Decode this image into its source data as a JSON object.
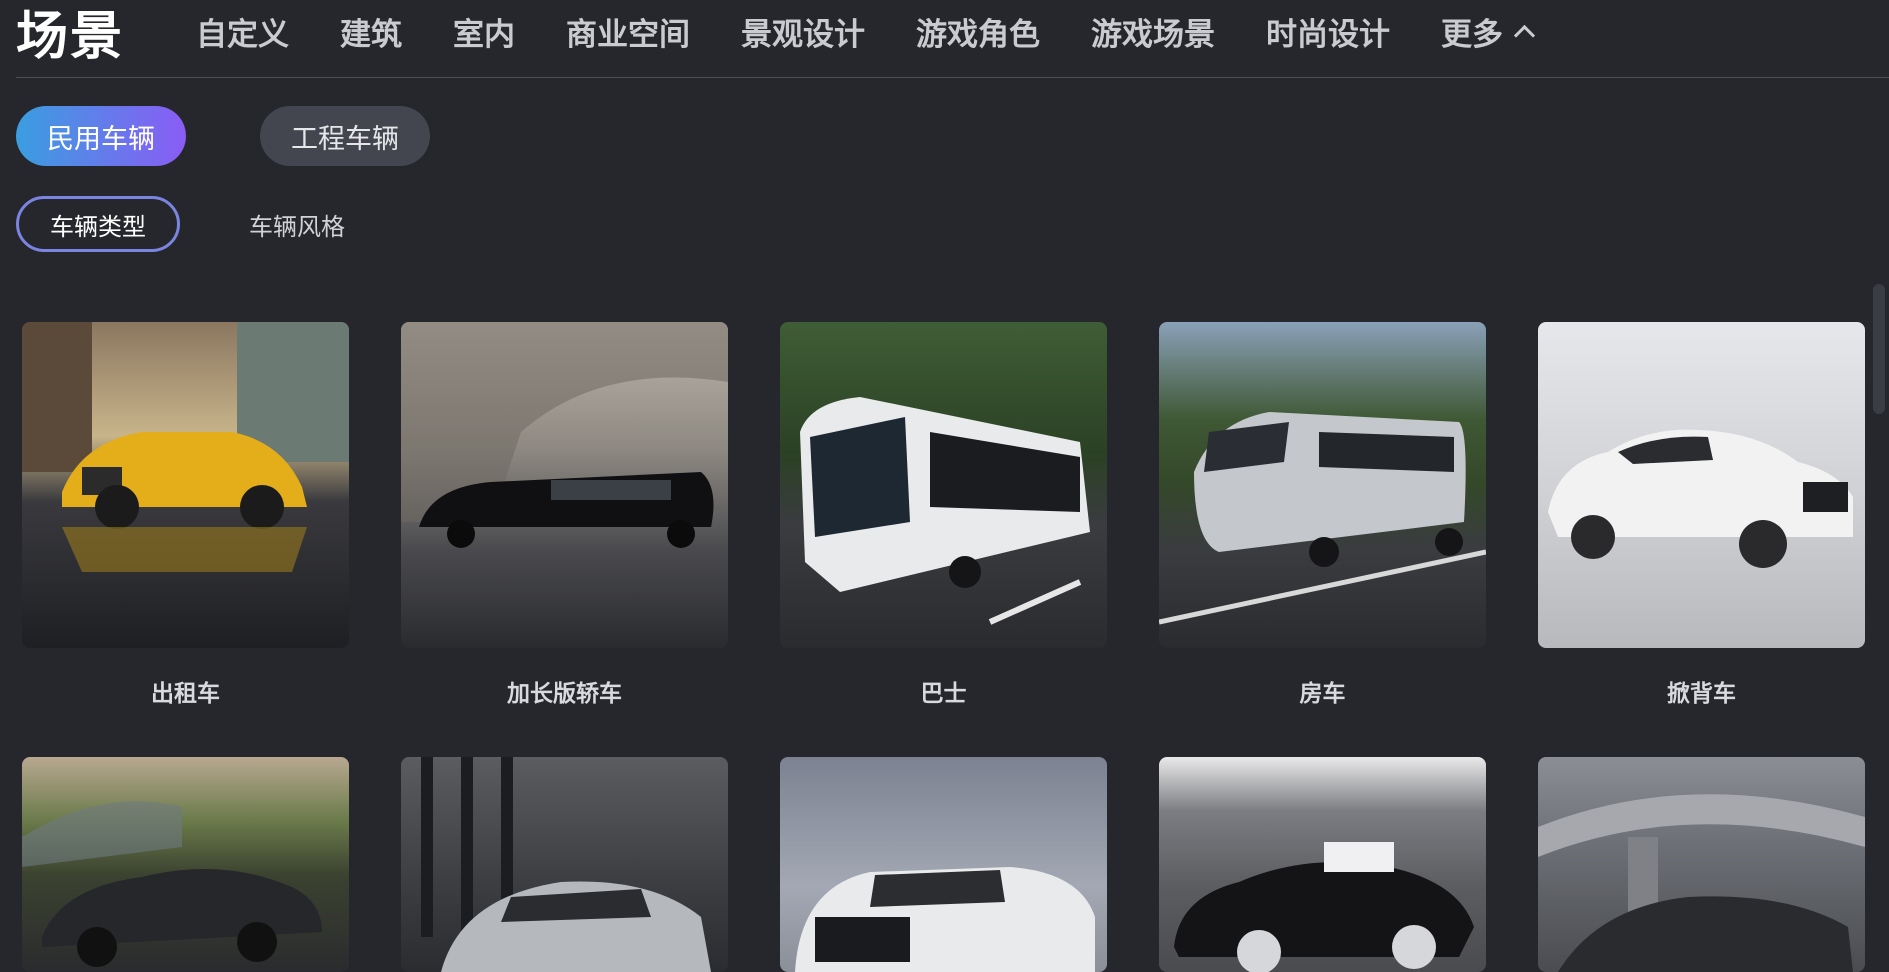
{
  "header": {
    "logo": "场景",
    "nav": [
      "自定义",
      "建筑",
      "室内",
      "商业空间",
      "景观设计",
      "游戏角色",
      "游戏场景",
      "时尚设计"
    ],
    "more_label": "更多"
  },
  "category_pills": [
    {
      "label": "民用车辆",
      "active": true
    },
    {
      "label": "工程车辆",
      "active": false
    }
  ],
  "sub_tabs": [
    {
      "label": "车辆类型",
      "active": true
    },
    {
      "label": "车辆风格",
      "active": false
    }
  ],
  "cards": [
    {
      "label": "出租车",
      "image": "yellow taxi on wet city street"
    },
    {
      "label": "加长版轿车",
      "image": "black stretch limousine under concrete structure"
    },
    {
      "label": "巴士",
      "image": "white coach bus on road with trees"
    },
    {
      "label": "房车",
      "image": "silver motorhome on highway"
    },
    {
      "label": "掀背车",
      "image": "white hatchback car studio shot"
    },
    {
      "label": "",
      "image": "dark convertible sports car by mountains"
    },
    {
      "label": "",
      "image": "silver SUV in glass building"
    },
    {
      "label": "",
      "image": "white pickup truck"
    },
    {
      "label": "",
      "image": "black vintage race car in studio"
    },
    {
      "label": "",
      "image": "dark coupe under overpass"
    }
  ]
}
